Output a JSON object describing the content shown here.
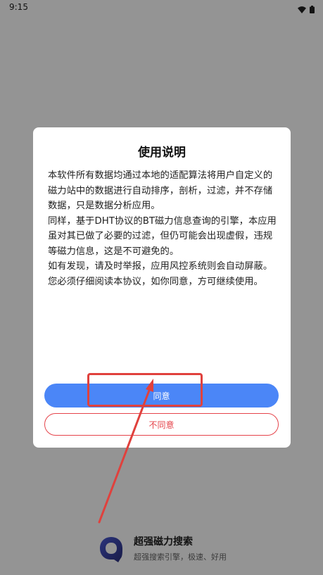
{
  "status_bar": {
    "time": "9:15",
    "icons": [
      "wifi-icon",
      "battery-icon"
    ]
  },
  "dialog": {
    "title": "使用说明",
    "paragraphs": [
      "本软件所有数据均通过本地的适配算法将用户自定义的磁力站中的数据进行自动排序，剖析，过滤，并不存储数据，只是数据分析应用。",
      "同样，基于DHT协议的BT磁力信息查询的引擎，本应用虽对其已做了必要的过滤，但仍可能会出现虚假，违规等磁力信息，这是不可避免的。",
      "如有发现，请及时举报，应用风控系统则会自动屏蔽。",
      "您必须仔细阅读本协议，如你同意，方可继续使用。"
    ],
    "agree_label": "同意",
    "disagree_label": "不同意"
  },
  "brand": {
    "name": "超强磁力搜索",
    "slogan": "超强搜索引擎，极速、好用",
    "logo_icon": "q-logo-icon"
  },
  "colors": {
    "primary": "#4b86f7",
    "danger": "#e5434a",
    "annotation": "#e0413d",
    "logo": "#3a3f8f"
  }
}
